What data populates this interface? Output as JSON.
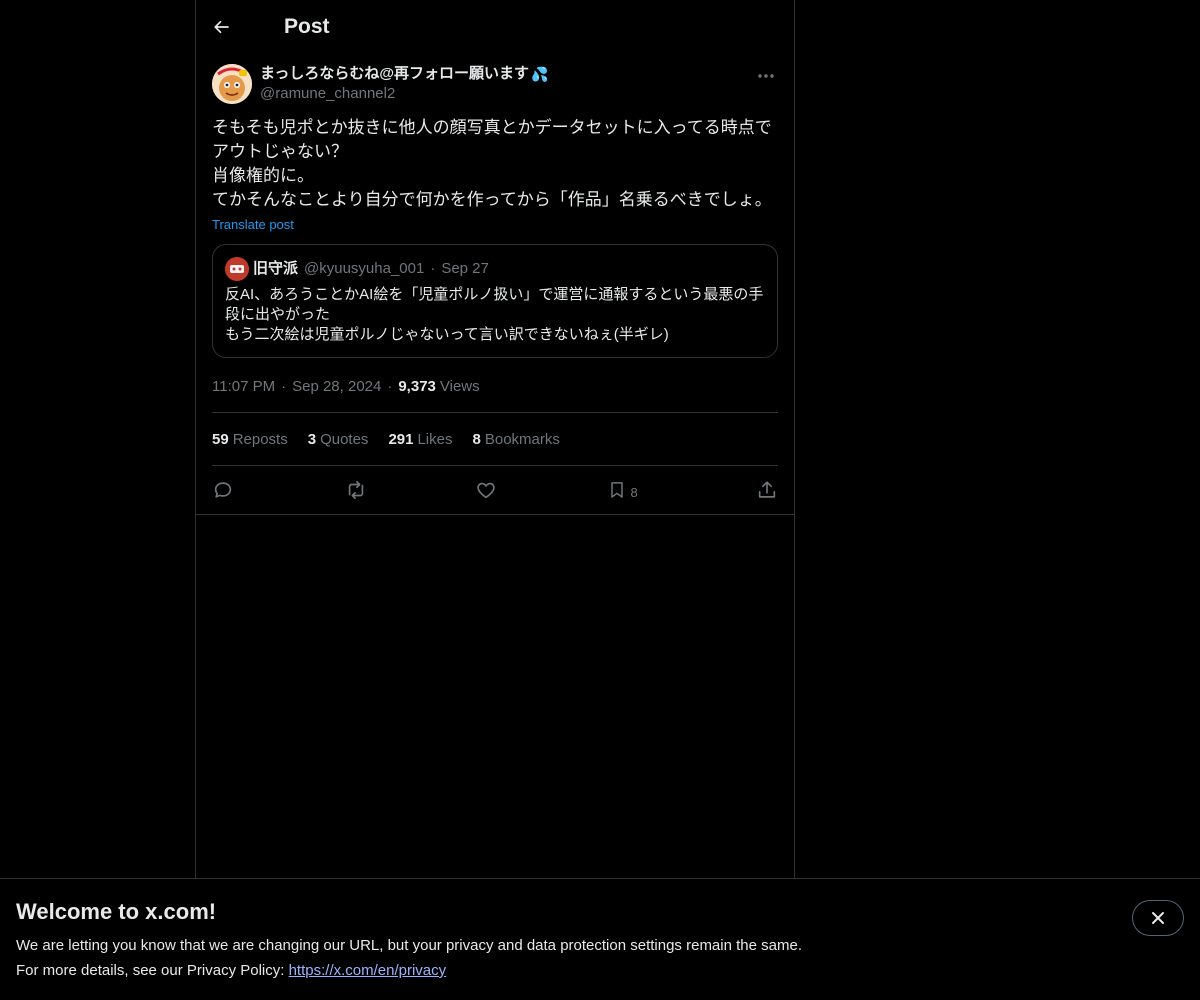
{
  "header": {
    "title": "Post",
    "back_icon": "arrow-left-icon"
  },
  "post": {
    "author": {
      "display_name": "まっしろならむね@再フォロー願います",
      "name_emoji": "💦",
      "handle": "@ramune_channel2"
    },
    "text_lines": [
      "そもそも児ポとか抜きに他人の顔写真とかデータセットに入ってる時点で",
      "アウトじゃない？",
      "肖像権的に。",
      "てかそんなことより自分で何かを作ってから「作品」名乗るべきでしょ。"
    ],
    "translate_label": "Translate post",
    "quoted": {
      "display_name": "旧守派",
      "handle": "@kyuusyuha_001",
      "separator": "·",
      "date": "Sep 27",
      "text_lines": [
        "反AI、あろうことかAI絵を「児童ポルノ扱い」で運営に通報するという最悪の手",
        "段に出やがった",
        "もう二次絵は児童ポルノじゃないって言い訳できないねぇ(半ギレ)"
      ]
    },
    "time": "11:07 PM",
    "separator": "·",
    "date": "Sep 28, 2024",
    "views_count": "9,373",
    "views_label": "Views",
    "stats": {
      "reposts_count": "59",
      "reposts_label": "Reposts",
      "quotes_count": "3",
      "quotes_label": "Quotes",
      "likes_count": "291",
      "likes_label": "Likes",
      "bookmarks_count": "8",
      "bookmarks_label": "Bookmarks"
    },
    "actions": {
      "reply_icon": "reply-icon",
      "repost_icon": "repost-icon",
      "like_icon": "heart-icon",
      "bookmark_icon": "bookmark-icon",
      "bookmark_count": "8",
      "share_icon": "share-icon"
    }
  },
  "banner": {
    "title": "Welcome to x.com!",
    "line1": "We are letting you know that we are changing our URL, but your privacy and data protection settings remain the same.",
    "line2_prefix": "For more details, see our Privacy Policy: ",
    "privacy_link": "https://x.com/en/privacy",
    "close_icon": "close-icon"
  },
  "colors": {
    "background": "#000000",
    "text": "#e7e9ea",
    "muted": "#71767b",
    "accent": "#1d9bf0",
    "border": "#2f3336",
    "link": "#9bb3ff"
  }
}
